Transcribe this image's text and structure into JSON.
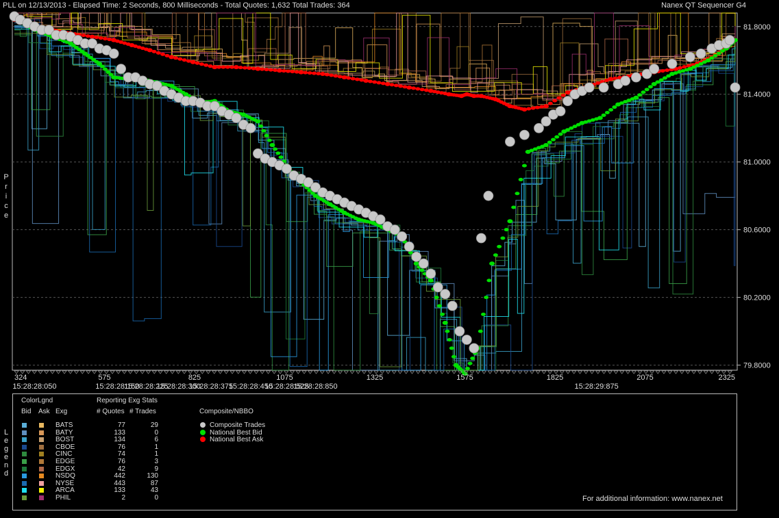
{
  "header": {
    "title_left": "PLL on 12/13/2013  -  Elapsed Time: 2 Seconds, 800 Milliseconds  -  Total Quotes: 1,632  Total Trades: 364",
    "title_right": "Nanex QT Sequencer G4"
  },
  "axis": {
    "y_label": "Price",
    "y_ticks": [
      "81.8000",
      "81.4000",
      "81.0000",
      "80.6000",
      "80.2000",
      "79.8000"
    ],
    "x_seq_labels": [
      "324",
      "575",
      "825",
      "1075",
      "1325",
      "1575",
      "1825",
      "2075",
      "2325"
    ],
    "x_time_labels": [
      "15:28:28:050",
      "15:28:28:150",
      "15:28:28:225",
      "15:28:28:300",
      "15:28:28:375",
      "15:28:28:450",
      "15:28:28:525",
      "15:28:28:850",
      "15:28:29:875"
    ]
  },
  "legend": {
    "side_label": "Legend",
    "header_colorlgnd": "ColorLgnd",
    "header_stats": "Reporting Exg Stats",
    "col_bid": "Bid",
    "col_ask": "Ask",
    "col_exg": "Exg",
    "col_quotes": "# Quotes",
    "col_trades": "# Trades",
    "nbbo_title": "Composite/NBBO",
    "nbbo_items": [
      {
        "label": "Composite Trades",
        "color": "#c8c8c8"
      },
      {
        "label": "National Best Bid",
        "color": "#00e000"
      },
      {
        "label": "National Best Ask",
        "color": "#ff0000"
      }
    ],
    "exchanges": [
      {
        "exg": "BATS",
        "quotes": "77",
        "trades": "29",
        "bid_color": "#5aaed8",
        "ask_color": "#e8b860"
      },
      {
        "exg": "BATY",
        "quotes": "133",
        "trades": "0",
        "bid_color": "#5f8fbf",
        "ask_color": "#d89858"
      },
      {
        "exg": "BOST",
        "quotes": "134",
        "trades": "6",
        "bid_color": "#3aa0c8",
        "ask_color": "#c8a070"
      },
      {
        "exg": "CBOE",
        "quotes": "76",
        "trades": "1",
        "bid_color": "#1a4a90",
        "ask_color": "#a07040"
      },
      {
        "exg": "CINC",
        "quotes": "74",
        "trades": "1",
        "bid_color": "#2e8a3e",
        "ask_color": "#a08020"
      },
      {
        "exg": "EDGE",
        "quotes": "76",
        "trades": "3",
        "bid_color": "#3aa048",
        "ask_color": "#b07838"
      },
      {
        "exg": "EDGX",
        "quotes": "42",
        "trades": "9",
        "bid_color": "#1e7a3a",
        "ask_color": "#b06848"
      },
      {
        "exg": "NSDQ",
        "quotes": "442",
        "trades": "130",
        "bid_color": "#2a9ae0",
        "ask_color": "#e88a20"
      },
      {
        "exg": "NYSE",
        "quotes": "443",
        "trades": "87",
        "bid_color": "#1a6ab0",
        "ask_color": "#f0a0a0"
      },
      {
        "exg": "ARCA",
        "quotes": "133",
        "trades": "43",
        "bid_color": "#20e0f0",
        "ask_color": "#f0f000"
      },
      {
        "exg": "PHIL",
        "quotes": "2",
        "trades": "0",
        "bid_color": "#6a9a3a",
        "ask_color": "#a03070"
      }
    ],
    "footer_note": "For additional information: www.nanex.net"
  },
  "chart_data": {
    "type": "scatter",
    "title": "PLL on 12/13/2013",
    "ylabel": "Price",
    "xlabel": "",
    "ylim": [
      79.77,
      81.88
    ],
    "xlim": [
      324,
      2325
    ],
    "grid": true,
    "series": [
      {
        "name": "National Best Ask",
        "color": "#ff0000",
        "x": [
          324,
          380,
          430,
          480,
          540,
          600,
          650,
          700,
          760,
          820,
          880,
          940,
          1000,
          1060,
          1120,
          1180,
          1240,
          1300,
          1360,
          1420,
          1480,
          1530,
          1565,
          1580,
          1600,
          1620,
          1660,
          1700,
          1740,
          1800,
          1860,
          1920,
          1980,
          2040,
          2100,
          2160,
          2220,
          2270,
          2325
        ],
        "y": [
          81.84,
          81.8,
          81.78,
          81.76,
          81.74,
          81.72,
          81.69,
          81.66,
          81.62,
          81.59,
          81.56,
          81.56,
          81.55,
          81.54,
          81.53,
          81.52,
          81.5,
          81.48,
          81.46,
          81.44,
          81.42,
          81.4,
          81.39,
          81.4,
          81.39,
          81.39,
          81.37,
          81.33,
          81.31,
          81.33,
          81.41,
          81.45,
          81.49,
          81.51,
          81.53,
          81.55,
          81.58,
          81.63,
          81.72
        ]
      },
      {
        "name": "National Best Bid",
        "color": "#00e000",
        "x": [
          324,
          380,
          430,
          480,
          520,
          560,
          600,
          640,
          680,
          720,
          760,
          800,
          840,
          880,
          920,
          960,
          1000,
          1040,
          1080,
          1120,
          1160,
          1200,
          1240,
          1280,
          1320,
          1360,
          1400,
          1440,
          1480,
          1520,
          1550,
          1575,
          1610,
          1650,
          1700,
          1750,
          1800,
          1850,
          1900,
          1950,
          2000,
          2050,
          2100,
          2150,
          2200,
          2250,
          2300,
          2325
        ],
        "y": [
          81.85,
          81.78,
          81.74,
          81.7,
          81.64,
          81.58,
          81.5,
          81.49,
          81.49,
          81.47,
          81.45,
          81.4,
          81.35,
          81.36,
          81.3,
          81.28,
          81.24,
          81.1,
          80.98,
          80.88,
          80.8,
          80.75,
          80.7,
          80.66,
          80.64,
          80.6,
          80.56,
          80.4,
          80.3,
          80.05,
          79.8,
          79.75,
          79.9,
          80.4,
          80.65,
          81.06,
          81.1,
          81.18,
          81.23,
          81.26,
          81.34,
          81.38,
          81.46,
          81.52,
          81.55,
          81.6,
          81.67,
          81.72
        ]
      },
      {
        "name": "Composite Trades",
        "color": "#c8c8c8",
        "x": [
          324,
          340,
          360,
          380,
          400,
          420,
          440,
          460,
          480,
          500,
          520,
          540,
          560,
          580,
          600,
          620,
          640,
          660,
          680,
          700,
          720,
          740,
          760,
          780,
          800,
          820,
          840,
          860,
          880,
          900,
          920,
          940,
          960,
          980,
          1000,
          1020,
          1040,
          1060,
          1080,
          1100,
          1120,
          1140,
          1160,
          1180,
          1200,
          1220,
          1240,
          1260,
          1280,
          1300,
          1320,
          1340,
          1360,
          1380,
          1400,
          1420,
          1440,
          1460,
          1480,
          1500,
          1520,
          1540,
          1560,
          1580,
          1600,
          1620,
          1640,
          1700,
          1740,
          1780,
          1800,
          1820,
          1840,
          1860,
          1880,
          1900,
          1920,
          1960,
          2000,
          2020,
          2050,
          2080,
          2100,
          2150,
          2200,
          2230,
          2260,
          2280,
          2300,
          2310,
          2325
        ],
        "y": [
          81.86,
          81.84,
          81.82,
          81.8,
          81.78,
          81.78,
          81.75,
          81.75,
          81.74,
          81.72,
          81.7,
          81.7,
          81.67,
          81.66,
          81.64,
          81.55,
          81.5,
          81.5,
          81.48,
          81.46,
          81.45,
          81.42,
          81.4,
          81.38,
          81.36,
          81.36,
          81.35,
          81.33,
          81.33,
          81.3,
          81.28,
          81.26,
          81.22,
          81.2,
          81.05,
          81.02,
          81.0,
          80.98,
          80.96,
          80.92,
          80.9,
          80.88,
          80.85,
          80.82,
          80.8,
          80.78,
          80.76,
          80.74,
          80.72,
          80.7,
          80.68,
          80.66,
          80.62,
          80.6,
          80.56,
          80.5,
          80.44,
          80.4,
          80.34,
          80.26,
          80.22,
          80.15,
          80.0,
          79.95,
          79.9,
          80.55,
          80.8,
          81.12,
          81.16,
          81.2,
          81.24,
          81.28,
          81.3,
          81.36,
          81.4,
          81.42,
          81.44,
          81.44,
          81.46,
          81.48,
          81.5,
          81.52,
          81.55,
          81.58,
          81.62,
          81.64,
          81.67,
          81.69,
          81.7,
          81.72,
          81.44
        ]
      }
    ]
  }
}
